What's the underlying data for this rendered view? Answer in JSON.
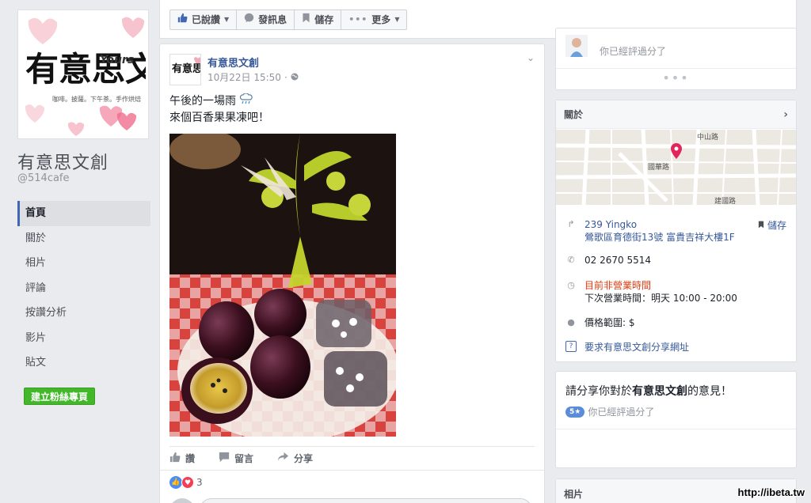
{
  "page": {
    "logo_text_main": "有意思文創",
    "logo_text_yours": "Yours",
    "logo_sub": "咖啡。披薩。下午茶。手作烘焙",
    "name": "有意思文創",
    "handle": "@514cafe"
  },
  "nav": {
    "items": [
      {
        "label": "首頁",
        "active": true
      },
      {
        "label": "關於"
      },
      {
        "label": "相片"
      },
      {
        "label": "評論"
      },
      {
        "label": "按讚分析"
      },
      {
        "label": "影片"
      },
      {
        "label": "貼文"
      }
    ],
    "create_label": "建立粉絲專頁"
  },
  "toolbar": {
    "liked": "已說讚",
    "message": "發訊息",
    "save": "儲存",
    "more": "更多"
  },
  "post": {
    "author": "有意思文創",
    "date": "10月22日 15:50",
    "dot": "·",
    "line1": "午後的一場雨",
    "line2": "來個百香果果凍吧！",
    "like_label": "讚",
    "comment_label": "留言",
    "share_label": "分享",
    "reaction_count": "3"
  },
  "review_top": {
    "reviewed_text": "你已經評過分了"
  },
  "about": {
    "title": "關於",
    "map_road_1": "中山路",
    "map_road_2": "國華路",
    "map_road_3": "建國路",
    "address_line1": "239 Yingko",
    "address_line2": "鶯歌區育德街13號 富貴吉祥大樓1F",
    "save_label": "儲存",
    "phone": "02 2670 5514",
    "status": "目前非營業時間",
    "next_hours": "下次營業時間：明天 10:00 - 20:00",
    "price": "價格範圍: $",
    "request_link": "要求有意思文創分享網址"
  },
  "share": {
    "title_prefix": "請分享你對於",
    "title_name": "有意思文創",
    "title_suffix": "的意見！",
    "badge": "5★",
    "sub": "你已經評過分了"
  },
  "photos": {
    "title": "相片"
  },
  "watermark": "http://ibeta.tw"
}
